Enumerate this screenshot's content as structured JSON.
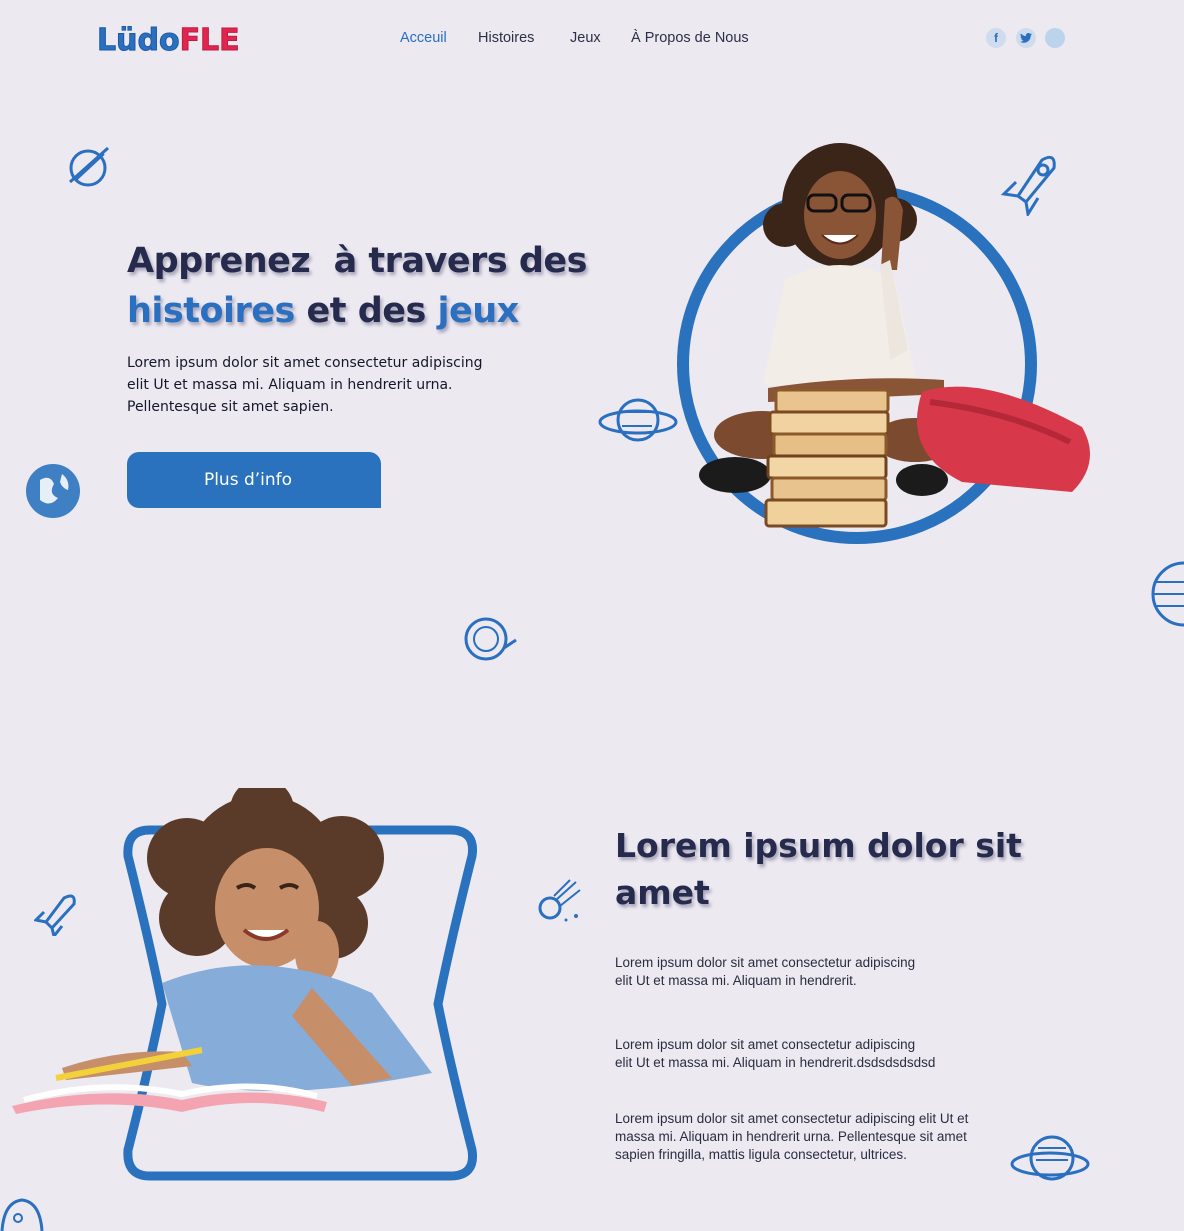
{
  "brand": {
    "logo_part1": "Lüdo",
    "logo_part2": "FLE",
    "primary": "#2a72bd",
    "accent": "#e0264f",
    "background": "#ece9f1"
  },
  "nav": {
    "items": [
      {
        "label": "Acceuil",
        "active": true
      },
      {
        "label": "Histoires",
        "active": false
      },
      {
        "label": "Jeux",
        "active": false
      },
      {
        "label": "À Propos de Nous",
        "active": false
      }
    ]
  },
  "social": {
    "facebook": "f",
    "twitter_icon": "twitter-icon",
    "third_icon": "social-icon"
  },
  "hero": {
    "title_line1": "Apprenez  à travers des",
    "title_line2_a": "histoires",
    "title_line2_b": "et des",
    "title_line2_c": "jeux",
    "text": "Lorem ipsum dolor sit amet consectetur adipiscing elit Ut et massa mi. Aliquam in hendrerit urna. Pellentesque sit amet sapien.",
    "cta": "Plus d’info"
  },
  "section2": {
    "title": "Lorem ipsum dolor sit amet",
    "paragraphs": [
      "Lorem ipsum dolor sit amet consectetur adipiscing\nelit Ut et massa mi. Aliquam in hendrerit.",
      "Lorem ipsum dolor sit amet consectetur adipiscing\nelit Ut et massa mi. Aliquam in hendrerit.dsdsdsdsdsd",
      "Lorem ipsum dolor sit amet consectetur adipiscing elit Ut et\nmassa mi. Aliquam in hendrerit urna. Pellentesque sit amet\nsapien fringilla, mattis ligula consectetur, ultrices."
    ]
  }
}
